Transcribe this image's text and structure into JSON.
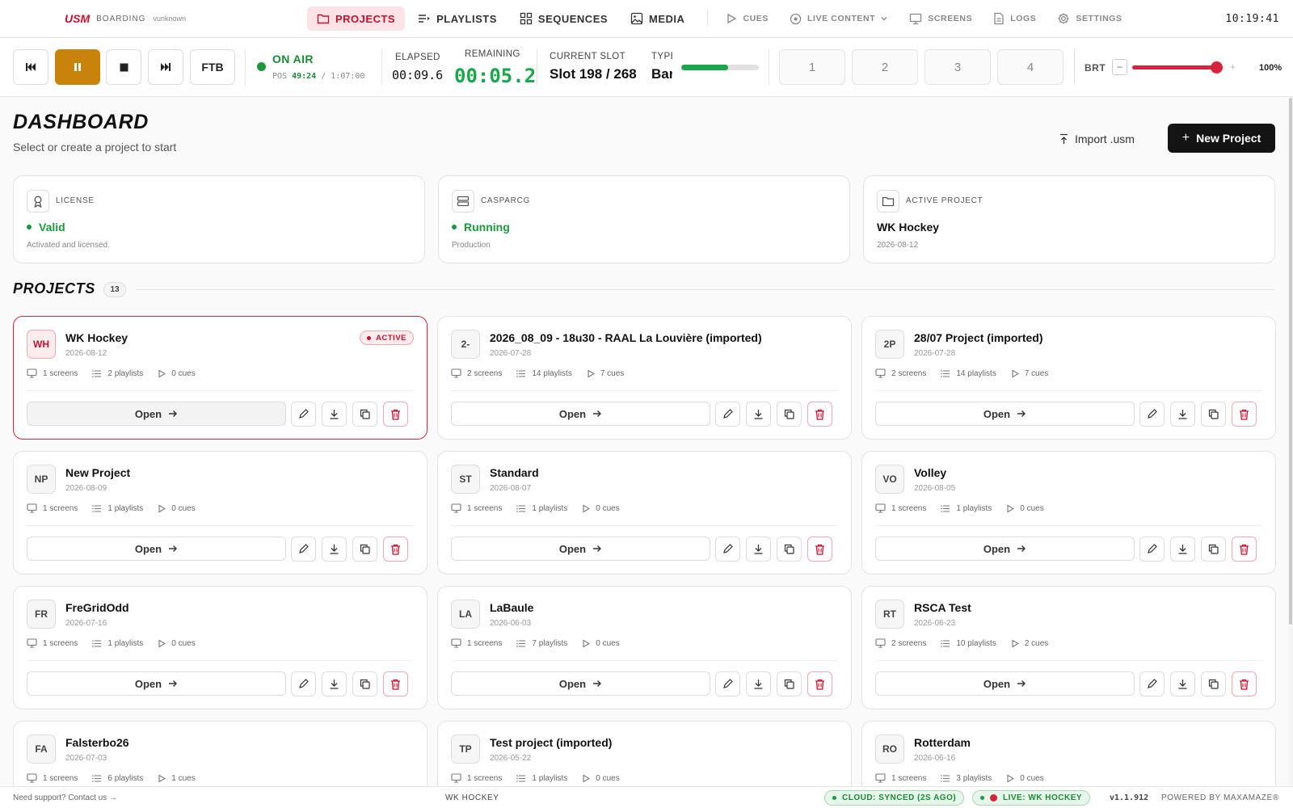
{
  "app": {
    "logo": "USM",
    "section": "BOARDING",
    "user": "vunknown"
  },
  "nav": {
    "projects": "PROJECTS",
    "playlists": "PLAYLISTS",
    "sequences": "SEQUENCES",
    "media": "MEDIA",
    "cues": "CUES",
    "live_content": "LIVE CONTENT",
    "screens": "SCREENS",
    "logs": "LOGS",
    "settings": "SETTINGS"
  },
  "clock": "10:19:41",
  "transport": {
    "ftb_label": "FTB",
    "status": "ON AIR",
    "pos_label": "POS",
    "pos_current": "49:24",
    "pos_total": "/ 1:07:00",
    "elapsed_label": "ELAPSED",
    "elapsed_value": "00:09.6",
    "remaining_label": "REMAINING",
    "remaining_value": "00:05.2",
    "current_slot_label": "CURRENT SLOT",
    "current_slot_value": "Slot 198 / 268",
    "type_label": "TYPE",
    "type_value": "Bar",
    "type_progress": 0.6,
    "slots": [
      "1",
      "2",
      "3",
      "4"
    ],
    "brightness_label": "BRT",
    "brightness_minus": "−",
    "brightness_plus": "+",
    "brightness_value": "100%",
    "brightness_level": 1.0
  },
  "dashboard": {
    "title": "DASHBOARD",
    "subtitle": "Select or create a project to start",
    "import_label": "Import .usm",
    "new_project_label": "New Project"
  },
  "info_cards": [
    {
      "label": "LICENSE",
      "value": "Valid",
      "sub": "Activated and licensed."
    },
    {
      "label": "CASPARCG",
      "value": "Running",
      "sub": "Production"
    },
    {
      "label": "ACTIVE PROJECT",
      "value": "WK Hockey",
      "sub": "2026-08-12"
    }
  ],
  "projects": {
    "heading": "PROJECTS",
    "count": "13",
    "open_label": "Open",
    "active_badge": "ACTIVE",
    "items": [
      {
        "initials": "WH",
        "name": "WK Hockey",
        "date": "2026-08-12",
        "screens": "1 screens",
        "playlists": "2 playlists",
        "cues": "0 cues"
      },
      {
        "initials": "2-",
        "name": "2026_08_09 - 18u30 - RAAL La Louvière (imported)",
        "date": "2026-07-28",
        "screens": "2 screens",
        "playlists": "14 playlists",
        "cues": "7 cues"
      },
      {
        "initials": "2P",
        "name": "28/07 Project (imported)",
        "date": "2026-07-28",
        "screens": "2 screens",
        "playlists": "14 playlists",
        "cues": "7 cues"
      },
      {
        "initials": "NP",
        "name": "New Project",
        "date": "2026-08-09",
        "screens": "1 screens",
        "playlists": "1 playlists",
        "cues": "0 cues"
      },
      {
        "initials": "ST",
        "name": "Standard",
        "date": "2026-08-07",
        "screens": "1 screens",
        "playlists": "1 playlists",
        "cues": "0 cues"
      },
      {
        "initials": "VO",
        "name": "Volley",
        "date": "2026-08-05",
        "screens": "1 screens",
        "playlists": "1 playlists",
        "cues": "0 cues"
      },
      {
        "initials": "FR",
        "name": "FreGridOdd",
        "date": "2026-07-16",
        "screens": "1 screens",
        "playlists": "1 playlists",
        "cues": "0 cues"
      },
      {
        "initials": "LA",
        "name": "LaBaule",
        "date": "2026-06-03",
        "screens": "1 screens",
        "playlists": "7 playlists",
        "cues": "0 cues"
      },
      {
        "initials": "RT",
        "name": "RSCA Test",
        "date": "2026-06-23",
        "screens": "2 screens",
        "playlists": "10 playlists",
        "cues": "2 cues"
      },
      {
        "initials": "FA",
        "name": "Falsterbo26",
        "date": "2026-07-03",
        "screens": "1 screens",
        "playlists": "6 playlists",
        "cues": "1 cues"
      },
      {
        "initials": "TP",
        "name": "Test project (imported)",
        "date": "2026-05-22",
        "screens": "1 screens",
        "playlists": "1 playlists",
        "cues": "0 cues"
      },
      {
        "initials": "RO",
        "name": "Rotterdam",
        "date": "2026-06-16",
        "screens": "1 screens",
        "playlists": "3 playlists",
        "cues": "0 cues"
      }
    ]
  },
  "footer": {
    "support": "Need support? Contact us →",
    "project": "WK HOCKEY",
    "cloud": "CLOUD: SYNCED (2S AGO)",
    "live": "LIVE: WK HOCKEY",
    "version": "v1.1.912",
    "powered": "POWERED BY MAXAMAZE®"
  },
  "colors": {
    "accent": "#c8102e",
    "on_air": "#1a9a3a",
    "pause": "#c9820a",
    "primary_button": "#141414"
  }
}
